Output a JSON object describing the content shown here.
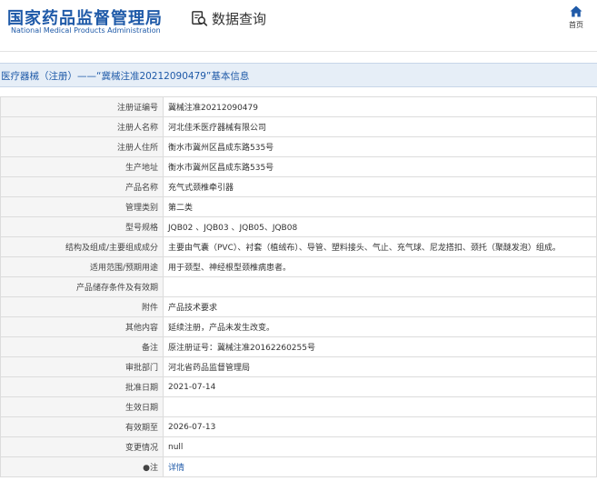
{
  "header": {
    "logo_cn": "国家药品监督管理局",
    "logo_en": "National Medical Products Administration",
    "search_label": "数据查询",
    "home_label": "首页"
  },
  "title": "医疗器械（注册）——“冀械注准20212090479”基本信息",
  "rows": [
    {
      "label": "注册证编号",
      "value": "冀械注准20212090479"
    },
    {
      "label": "注册人名称",
      "value": "河北佳禾医疗器械有限公司"
    },
    {
      "label": "注册人住所",
      "value": "衡水市冀州区昌成东路535号"
    },
    {
      "label": "生产地址",
      "value": "衡水市冀州区昌成东路535号"
    },
    {
      "label": "产品名称",
      "value": "充气式颈椎牵引器"
    },
    {
      "label": "管理类别",
      "value": "第二类"
    },
    {
      "label": "型号规格",
      "value": "JQB02 、JQB03 、JQB05、JQB08"
    },
    {
      "label": "结构及组成/主要组成成分",
      "value": "主要由气囊（PVC）、衬套（植绒布）、导管、塑料接头、气止、充气球、尼龙搭扣、颈托（聚醚发泡）组成。"
    },
    {
      "label": "适用范围/预期用途",
      "value": "用于颈型、神经根型颈椎病患者。"
    },
    {
      "label": "产品储存条件及有效期",
      "value": ""
    },
    {
      "label": "附件",
      "value": "产品技术要求"
    },
    {
      "label": "其他内容",
      "value": "延续注册，产品未发生改变。"
    },
    {
      "label": "备注",
      "value": "原注册证号：冀械注准20162260255号"
    },
    {
      "label": "审批部门",
      "value": "河北省药品监督管理局"
    },
    {
      "label": "批准日期",
      "value": "2021-07-14"
    },
    {
      "label": "生效日期",
      "value": ""
    },
    {
      "label": "有效期至",
      "value": "2026-07-13"
    },
    {
      "label": "变更情况",
      "value": "null"
    },
    {
      "label": "●注",
      "value": "详情"
    }
  ],
  "colors": {
    "brand": "#1f5aa8",
    "title_bg": "#e6eef7",
    "label_bg": "#f5f5f5",
    "border": "#dcdcdc"
  }
}
